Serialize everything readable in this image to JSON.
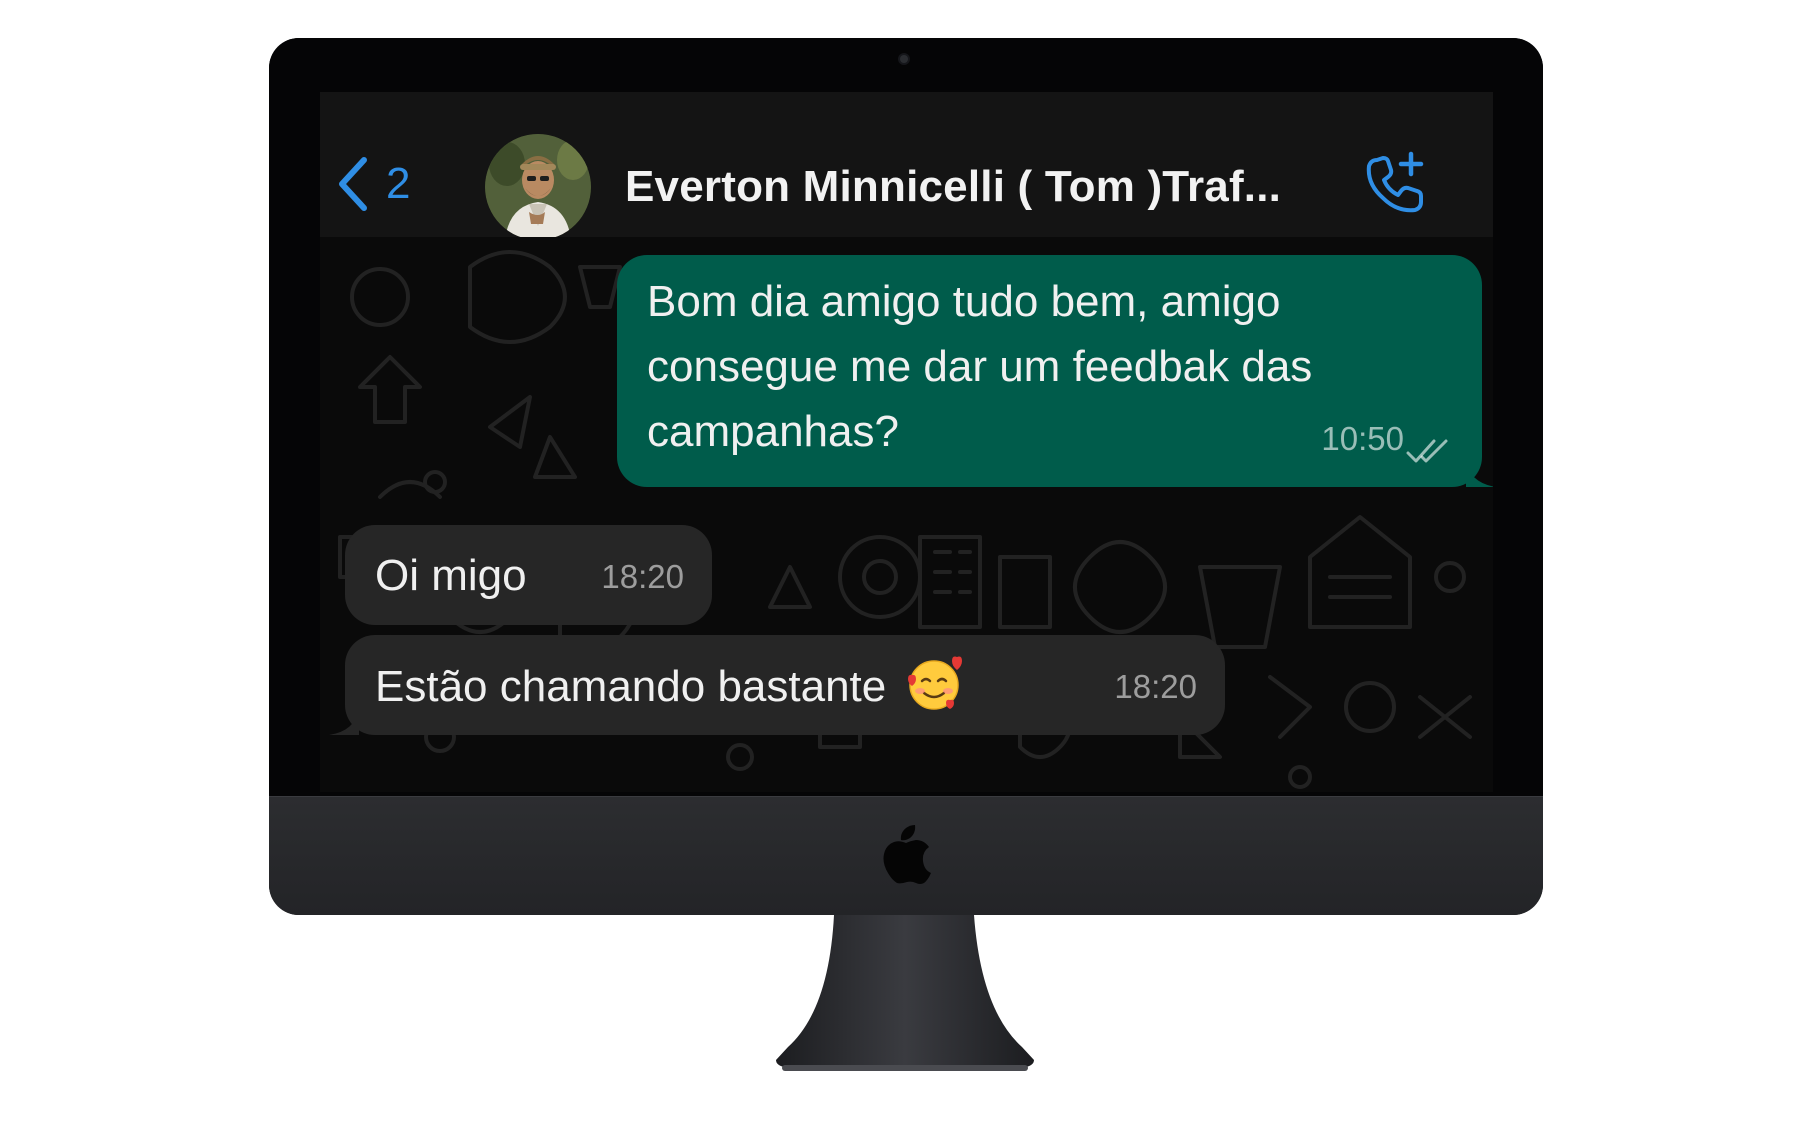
{
  "header": {
    "back_count": "2",
    "contact_name": "Everton Minnicelli ( Tom )Traf..."
  },
  "messages": [
    {
      "direction": "outgoing",
      "lines": [
        "Bom dia amigo tudo bem, amigo",
        "consegue me dar um feedbak das",
        "campanhas?"
      ],
      "time": "10:50",
      "status": "read"
    },
    {
      "direction": "incoming",
      "text": "Oi migo",
      "time": "18:20"
    },
    {
      "direction": "incoming",
      "text": "Estão chamando bastante",
      "emoji": "smiling-face-with-hearts",
      "time": "18:20"
    }
  ],
  "icons": {
    "back": "chevron-left-icon",
    "call": "phone-plus-icon",
    "ticks": "double-check-icon",
    "brand": "apple-logo"
  },
  "colors": {
    "accent": "#2f8ee5",
    "outgoing_bubble": "#005c4b",
    "incoming_bubble": "#262626",
    "header_bg": "#141414",
    "chat_bg": "#0a0a0a"
  }
}
